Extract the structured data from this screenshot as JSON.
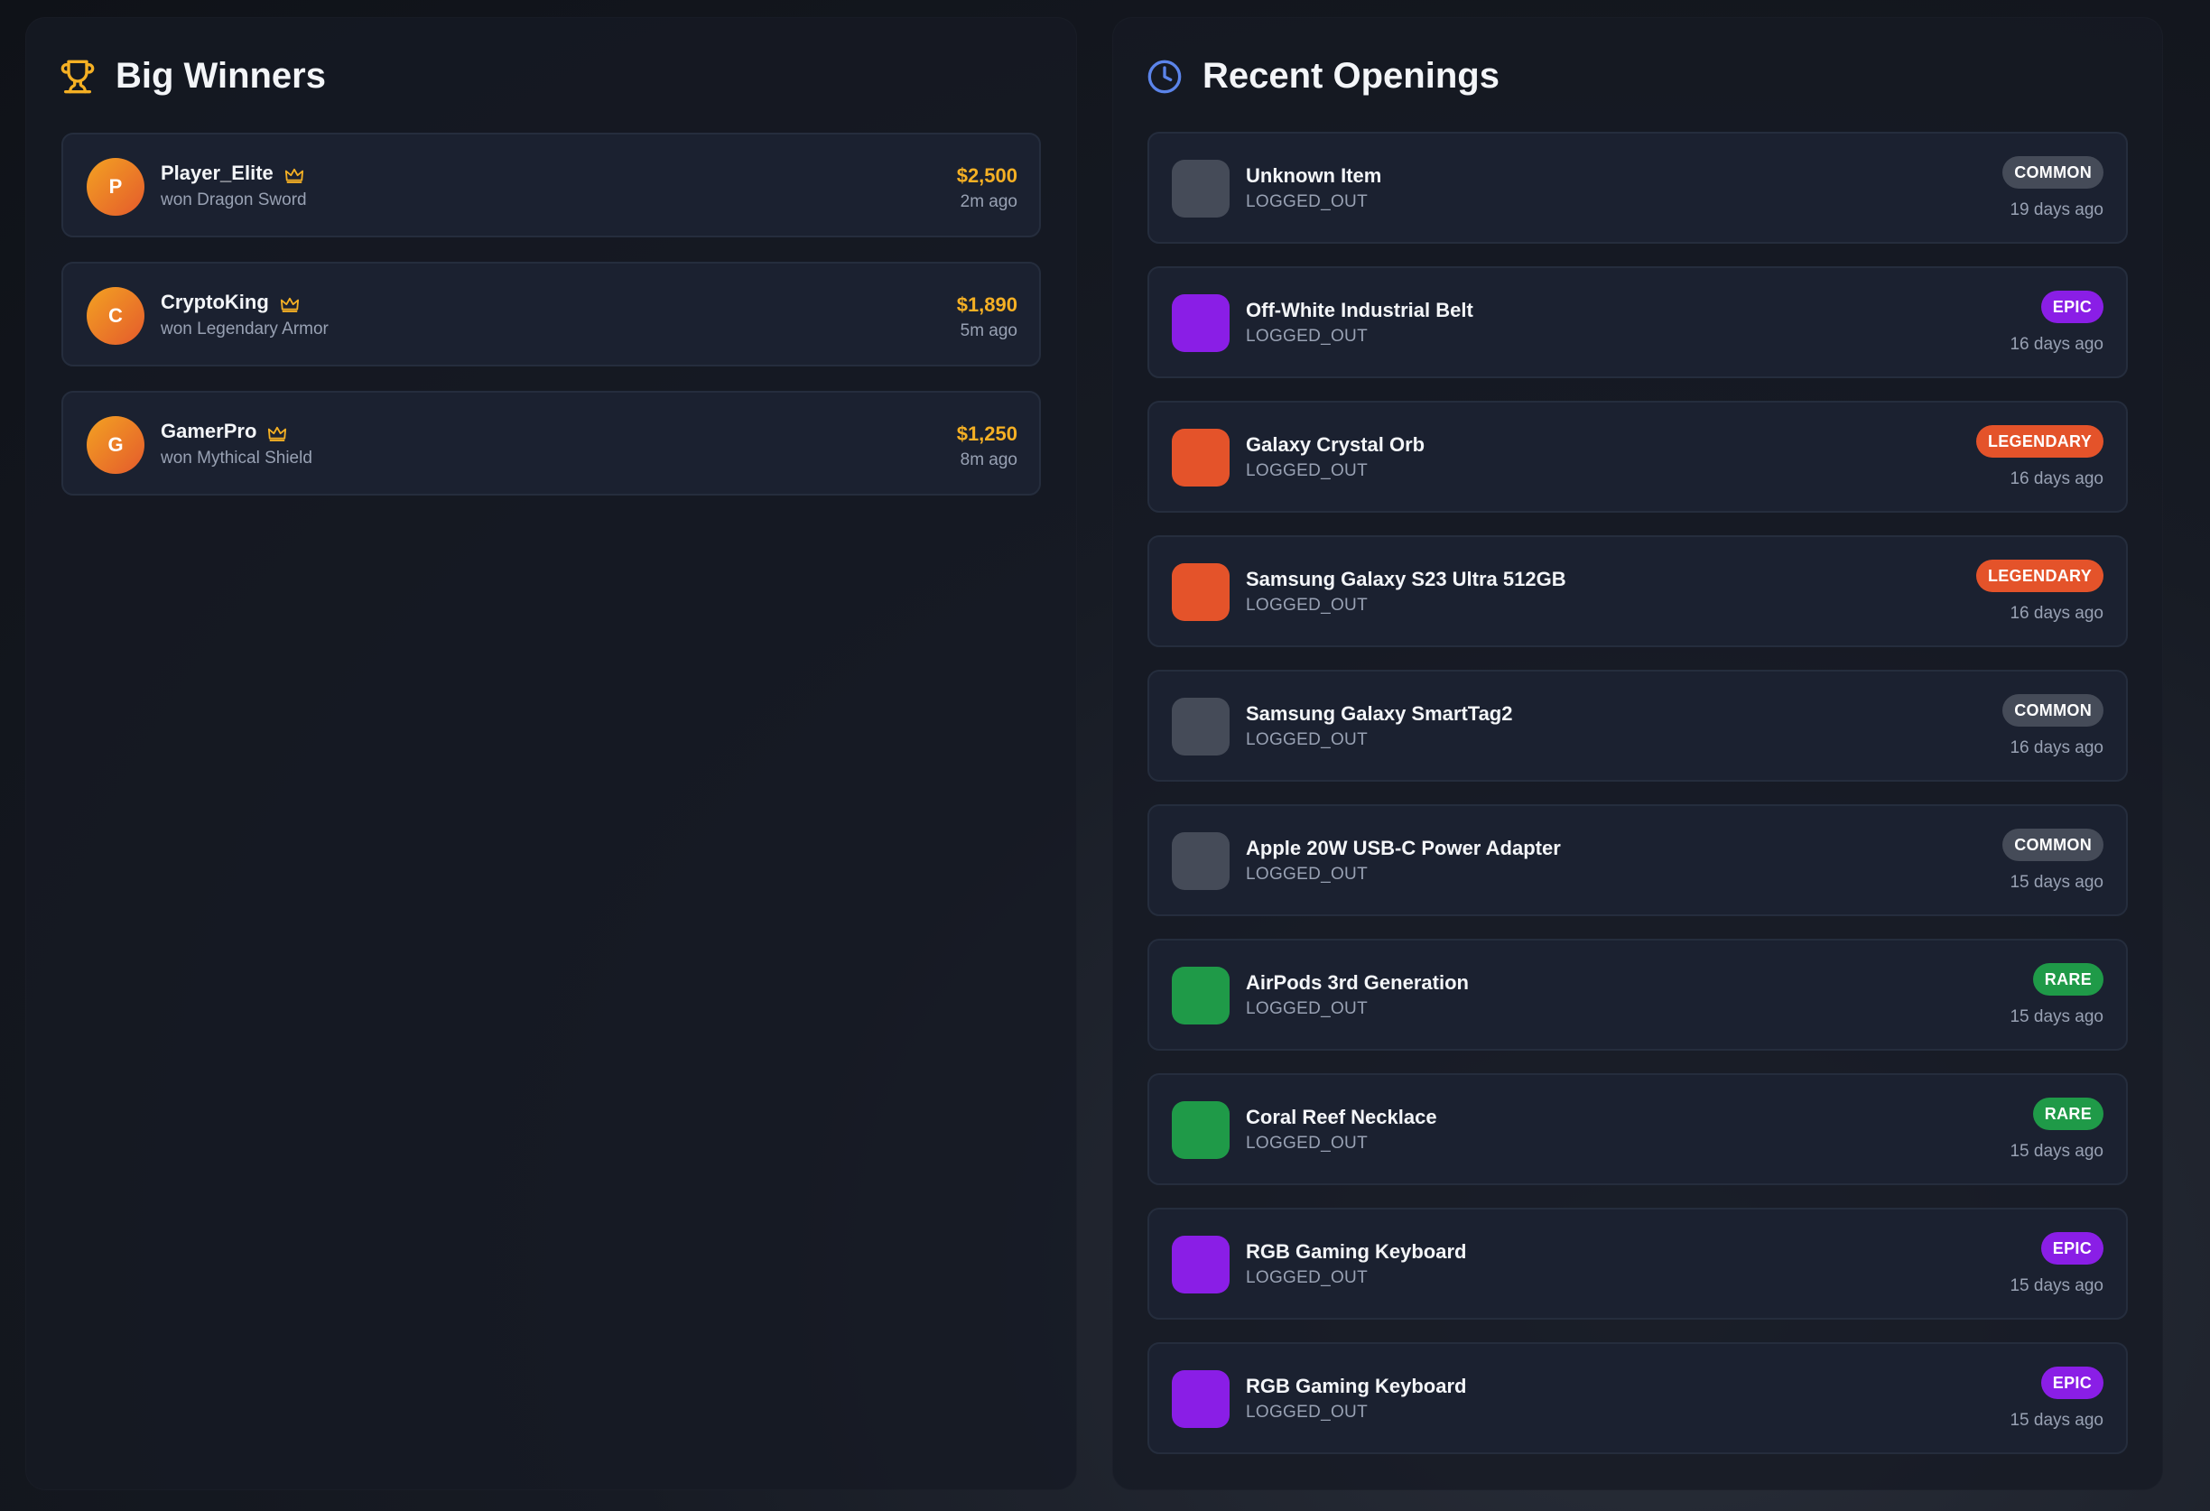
{
  "big_winners": {
    "title": "Big Winners",
    "icon": "trophy-icon",
    "accent": "#f5b024",
    "items": [
      {
        "initial": "P",
        "name": "Player_Elite",
        "prize": "won Dragon Sword",
        "amount": "$2,500",
        "time": "2m ago"
      },
      {
        "initial": "C",
        "name": "CryptoKing",
        "prize": "won Legendary Armor",
        "amount": "$1,890",
        "time": "5m ago"
      },
      {
        "initial": "G",
        "name": "GamerPro",
        "prize": "won Mythical Shield",
        "amount": "$1,250",
        "time": "8m ago"
      }
    ]
  },
  "recent_openings": {
    "title": "Recent Openings",
    "icon": "clock-icon",
    "accent": "#5b84ea",
    "rarity_colors": {
      "COMMON": "#454b58",
      "EPIC": "#8a1ee6",
      "LEGENDARY": "#e4532a",
      "RARE": "#1f9a48"
    },
    "items": [
      {
        "name": "Unknown Item",
        "user": "LOGGED_OUT",
        "rarity": "COMMON",
        "time": "19 days ago"
      },
      {
        "name": "Off-White Industrial Belt",
        "user": "LOGGED_OUT",
        "rarity": "EPIC",
        "time": "16 days ago"
      },
      {
        "name": "Galaxy Crystal Orb",
        "user": "LOGGED_OUT",
        "rarity": "LEGENDARY",
        "time": "16 days ago"
      },
      {
        "name": "Samsung Galaxy S23 Ultra 512GB",
        "user": "LOGGED_OUT",
        "rarity": "LEGENDARY",
        "time": "16 days ago"
      },
      {
        "name": "Samsung Galaxy SmartTag2",
        "user": "LOGGED_OUT",
        "rarity": "COMMON",
        "time": "16 days ago"
      },
      {
        "name": "Apple 20W USB-C Power Adapter",
        "user": "LOGGED_OUT",
        "rarity": "COMMON",
        "time": "15 days ago"
      },
      {
        "name": "AirPods 3rd Generation",
        "user": "LOGGED_OUT",
        "rarity": "RARE",
        "time": "15 days ago"
      },
      {
        "name": "Coral Reef Necklace",
        "user": "LOGGED_OUT",
        "rarity": "RARE",
        "time": "15 days ago"
      },
      {
        "name": "RGB Gaming Keyboard",
        "user": "LOGGED_OUT",
        "rarity": "EPIC",
        "time": "15 days ago"
      },
      {
        "name": "RGB Gaming Keyboard",
        "user": "LOGGED_OUT",
        "rarity": "EPIC",
        "time": "15 days ago"
      }
    ]
  }
}
